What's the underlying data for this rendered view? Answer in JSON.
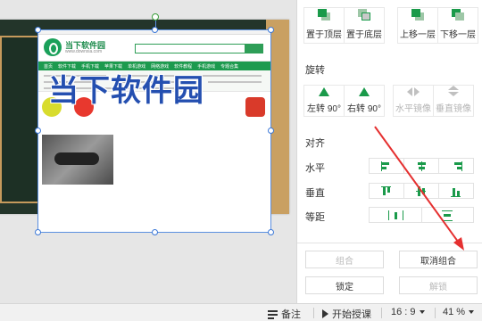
{
  "canvas": {
    "watermark": "当下软件园",
    "website": {
      "logo_text": "当下软件园",
      "logo_sub": "www.downxia.com",
      "nav_items": [
        "首页",
        "软件下载",
        "手机下载",
        "苹果下载",
        "单机游戏",
        "网络游戏",
        "软件教程",
        "手机游戏",
        "专题合集"
      ]
    }
  },
  "panel": {
    "layer": {
      "buttons": [
        {
          "label": "置于顶层",
          "icon": "bring-to-front-icon"
        },
        {
          "label": "置于底层",
          "icon": "send-to-back-icon"
        },
        {
          "label": "上移一层",
          "icon": "bring-forward-icon"
        },
        {
          "label": "下移一层",
          "icon": "send-backward-icon"
        }
      ]
    },
    "rotate": {
      "title": "旋转",
      "buttons": [
        {
          "label": "左转 90°",
          "icon": "rotate-left-icon",
          "enabled": true
        },
        {
          "label": "右转 90°",
          "icon": "rotate-right-icon",
          "enabled": true
        },
        {
          "label": "水平镜像",
          "icon": "flip-horizontal-icon",
          "enabled": false
        },
        {
          "label": "垂直镜像",
          "icon": "flip-vertical-icon",
          "enabled": false
        }
      ]
    },
    "align": {
      "title": "对齐",
      "horizontal_label": "水平",
      "vertical_label": "垂直",
      "distribute_label": "等距"
    },
    "group": {
      "group_label": "组合",
      "ungroup_label": "取消组合",
      "lock_label": "锁定",
      "unlock_label": "解锁"
    }
  },
  "statusbar": {
    "notes_label": "备注",
    "start_label": "开始授课",
    "ratio_label": "16 : 9",
    "zoom_label": "41 %"
  },
  "colors": {
    "accent_green": "#1a9a4a",
    "annotation_arrow": "#e53030",
    "selection_blue": "#5b8fe0"
  }
}
